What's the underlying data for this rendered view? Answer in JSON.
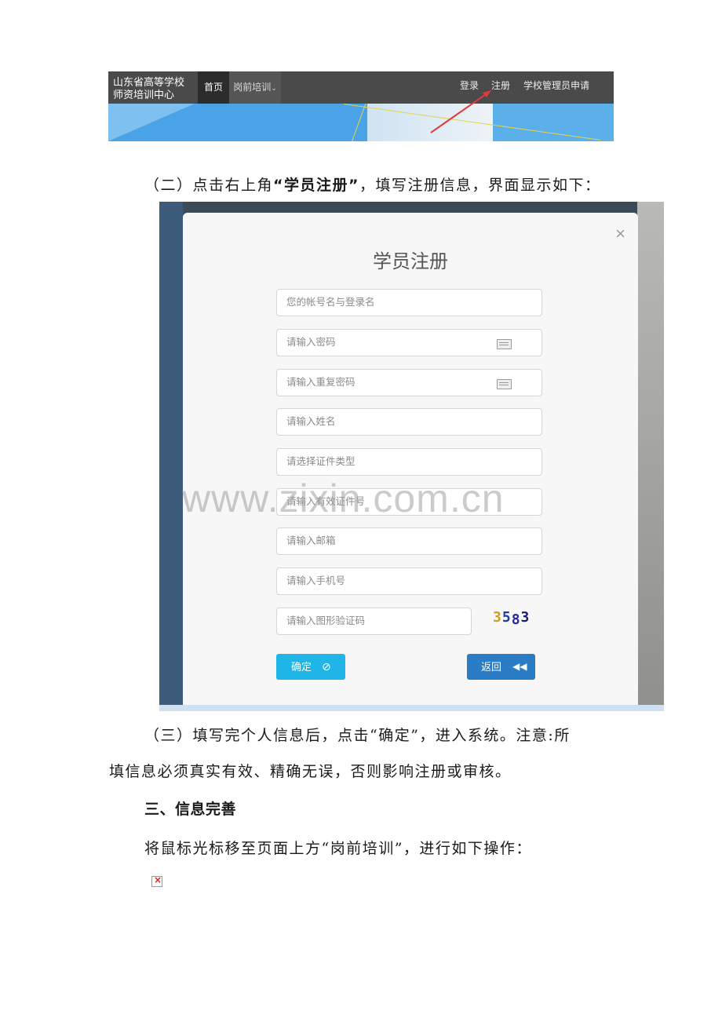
{
  "nav": {
    "brand_line1": "山东省高等学校",
    "brand_line2": "师资培训中心",
    "home": "首页",
    "training": "岗前培训",
    "training_caret": "⌄",
    "login": "登录",
    "register": "注册",
    "admin_apply": "学校管理员申请"
  },
  "para2": {
    "prefix": "（二）点击右上角",
    "bold": "“学员注册”",
    "suffix": "，填写注册信息，界面显示如下："
  },
  "modal": {
    "close": "×",
    "title": "学员注册",
    "fields": [
      "您的帐号名与登录名",
      "请输入密码",
      "请输入重复密码",
      "请输入姓名",
      "请选择证件类型",
      "请输入有效证件号",
      "请输入邮箱",
      "请输入手机号",
      "请输入图形验证码"
    ],
    "captcha": [
      "3",
      "5",
      "8",
      "3"
    ],
    "captcha_colors": [
      "#c9a21a",
      "#1f3aa8",
      "#2a2aa0",
      "#1a1a6e"
    ],
    "confirm": "确定",
    "confirm_icon": "check-circle-icon",
    "back": "返回",
    "back_icon": "fast-backward-icon"
  },
  "watermark": "www.zixin.com.cn",
  "para3_line1": "（三）填写完个人信息后，点击“确定”，进入系统。注意:所",
  "para3_line2": "填信息必须真实有效、精确无误，否则影响注册或审核。",
  "section3_heading": "三、信息完善",
  "para4": "将鼠标光标移至页面上方“岗前培训”，进行如下操作："
}
